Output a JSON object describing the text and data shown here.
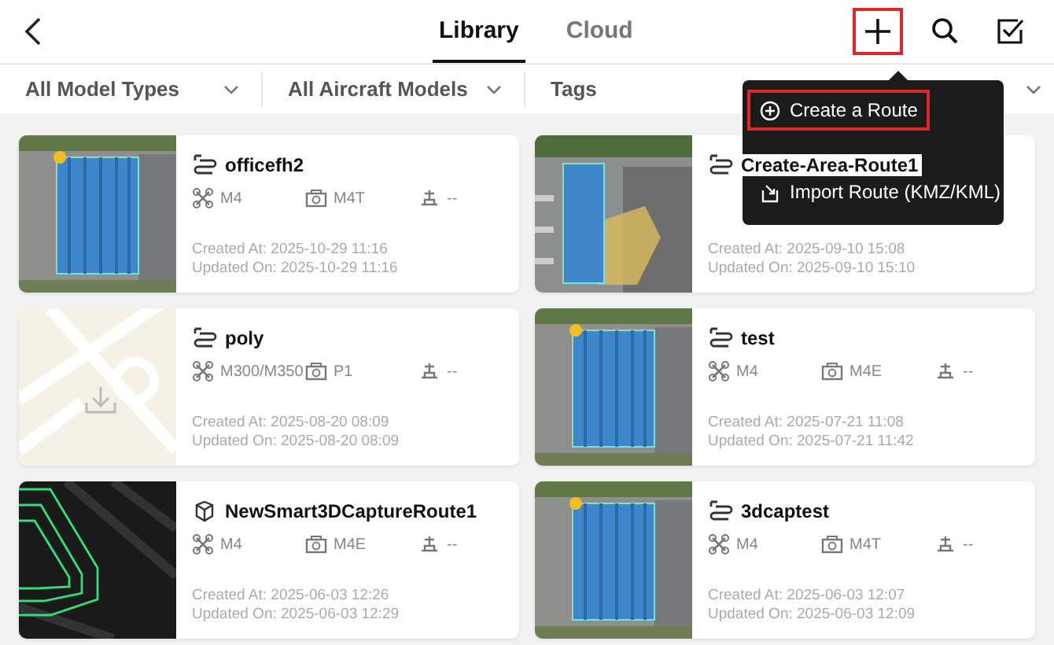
{
  "header": {
    "tabs": [
      {
        "label": "Library",
        "selected": true
      },
      {
        "label": "Cloud",
        "selected": false
      }
    ],
    "actions": [
      {
        "kind": "add",
        "highlighted": true
      },
      {
        "kind": "search",
        "highlighted": false
      },
      {
        "kind": "select",
        "highlighted": false
      }
    ]
  },
  "filters": [
    {
      "label": "All Model Types",
      "kind": "dropdown"
    },
    {
      "label": "All Aircraft Models",
      "kind": "dropdown"
    },
    {
      "label": "Tags",
      "kind": "plain"
    }
  ],
  "menu": {
    "items": [
      {
        "label": "Create a Route",
        "kind": "create",
        "highlighted": true
      },
      {
        "label": "Import Route (KMZ/KML)",
        "kind": "import",
        "highlighted": false
      }
    ]
  },
  "routes": [
    {
      "name": "officefh2",
      "route_icon": {
        "kind": "waypoint"
      },
      "thumbnail": {
        "kind": "aerial"
      },
      "drone": "M4",
      "camera": "M4T",
      "payload": "--",
      "created": "Created At: 2025-10-29 11:16",
      "updated": "Updated On: 2025-10-29 11:16"
    },
    {
      "name": "Create-Area-Route1",
      "route_icon": {
        "kind": "waypoint"
      },
      "thumbnail": {
        "kind": "aerial-area"
      },
      "created": "Created At: 2025-09-10 15:08",
      "updated": "Updated On: 2025-09-10 15:10"
    },
    {
      "name": "poly",
      "route_icon": {
        "kind": "waypoint"
      },
      "thumbnail": {
        "kind": "imported"
      },
      "drone": "M300/M350",
      "camera": "P1",
      "payload": "--",
      "created": "Created At: 2025-08-20 08:09",
      "updated": "Updated On: 2025-08-20 08:09"
    },
    {
      "name": "test",
      "route_icon": {
        "kind": "waypoint"
      },
      "thumbnail": {
        "kind": "aerial"
      },
      "drone": "M4",
      "camera": "M4E",
      "payload": "--",
      "created": "Created At: 2025-07-21 11:08",
      "updated": "Updated On: 2025-07-21 11:42"
    },
    {
      "name": "NewSmart3DCaptureRoute1",
      "route_icon": {
        "kind": "smart3d"
      },
      "thumbnail": {
        "kind": "pointcloud"
      },
      "drone": "M4",
      "camera": "M4E",
      "payload": "--",
      "created": "Created At: 2025-06-03 12:26",
      "updated": "Updated On: 2025-06-03 12:29"
    },
    {
      "name": "3dcaptest",
      "route_icon": {
        "kind": "waypoint"
      },
      "thumbnail": {
        "kind": "aerial"
      },
      "drone": "M4",
      "camera": "M4T",
      "payload": "--",
      "created": "Created At: 2025-06-03 12:07",
      "updated": "Updated On: 2025-06-03 12:09"
    }
  ]
}
